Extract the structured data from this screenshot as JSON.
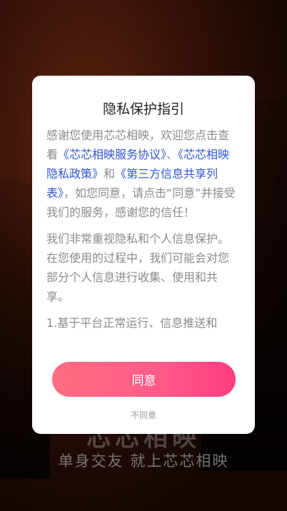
{
  "background": {
    "brand_text": "芯芯相映",
    "slogan": "单身交友 就上芯芯相映"
  },
  "dialog": {
    "title": "隐私保护指引",
    "para1": {
      "t1": "感谢您使用芯芯相映，欢迎您点击查看",
      "link1": "《芯芯相映服务协议》",
      "t2": "、",
      "link2": "《芯芯相映隐私政策》",
      "t3": "和",
      "link3": "《第三方信息共享列表》",
      "t4": "，如您同意，请点击“同意”并接受我们的服务，感谢您的信任！"
    },
    "para2": "我们非常重视隐私和个人信息保护。在您使用的过程中，我们可能会对您部分个人信息进行收集、使用和共享。",
    "para3": "1.基于平台正常运行、信息推送和",
    "agree_label": "同意",
    "disagree_label": "不同意",
    "accent_color": "#ff5a8a",
    "link_color": "#2f55d4"
  }
}
